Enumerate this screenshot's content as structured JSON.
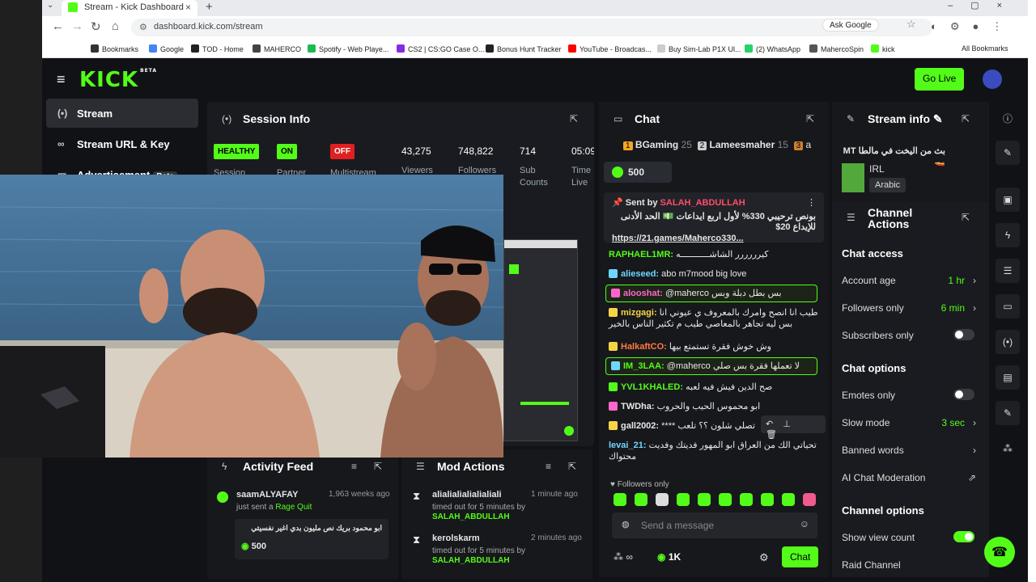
{
  "browser": {
    "tab_title": "Stream - Kick Dashboard",
    "url": "dashboard.kick.com/stream",
    "ask_google": "Ask Google",
    "bookmarks": [
      "Bookmarks",
      "Google",
      "TOD - Home",
      "MAHERCO",
      "Spotify - Web Playe...",
      "CS2 | CS:GO Case O...",
      "Bonus Hunt Tracker",
      "YouTube - Broadcas...",
      "Buy Sim-Lab P1X Ul...",
      "(2) WhatsApp",
      "MahercoSpin",
      "kick"
    ],
    "all_bookmarks": "All Bookmarks"
  },
  "app": {
    "logo": "KICK",
    "logo_beta": "BETA",
    "go_live": "Go Live"
  },
  "sidebar": {
    "items": [
      {
        "label": "Stream"
      },
      {
        "label": "Stream URL & Key"
      },
      {
        "label": "Advertisement",
        "badge": "Beta"
      }
    ]
  },
  "session": {
    "title": "Session Info",
    "tags": [
      {
        "label": "HEALTHY",
        "sub": "Session",
        "color": "#53fc18"
      },
      {
        "label": "ON",
        "sub": "Partner",
        "color": "#53fc18"
      },
      {
        "label": "OFF",
        "sub": "Multistream",
        "color": "#e02020"
      }
    ],
    "stats": [
      {
        "value": "43,275",
        "label": "Viewers"
      },
      {
        "value": "748,822",
        "label": "Followers"
      },
      {
        "value": "714",
        "label": "Sub Counts"
      },
      {
        "value": "05:09",
        "label": "Time Live"
      }
    ]
  },
  "chat": {
    "title": "Chat",
    "leaderboard": [
      {
        "rank": "1",
        "name": "BGaming",
        "value": "25"
      },
      {
        "rank": "2",
        "name": "Lameesmaher",
        "value": "15"
      },
      {
        "rank": "3",
        "name": "a",
        "value": ""
      }
    ],
    "goal_value": "500",
    "pinned": {
      "sent_by": "Sent by",
      "user": "SALAH_ABDULLAH",
      "text": "بونص ترحيبي 330% لأول اربع ايداعات 💵 الحد الأدنى للإيداع 20$",
      "link": "https://21.games/Maherco330..."
    },
    "messages": [
      {
        "user": "RAPHAEL1MR:",
        "text": "كيرررررر الشاشـــــــــــه",
        "color": "#53fc18"
      },
      {
        "user": "alieseed:",
        "text": "abo m7mood big love",
        "color": "#6fd6ff"
      },
      {
        "user": "alooshat:",
        "text": "@maherco بس بطل دبلة وبس",
        "color": "#ff66cc",
        "hl": true
      },
      {
        "user": "mizgagi:",
        "text": "طيب انا انصح وامرك بالمعروف ي عيوني انا بس ليه تجاهر بالمعاصي طيب م تكثير الناس بالخير",
        "color": "#f5d547"
      },
      {
        "user": "HalkaftCO:",
        "text": "وش خوش فقرة تستمتع بيها",
        "color": "#ff7a3d"
      },
      {
        "user": "IM_3LAA:",
        "text": "@maherco لا تعملها فقرة بس صلي",
        "color": "#53fc18",
        "hl": true
      },
      {
        "user": "YVL1KHALED:",
        "text": "صح الدين فيش فيه لعبه",
        "color": "#53fc18"
      },
      {
        "user": "TWDha:",
        "text": "ابو محموس الحيب والحروب",
        "color": "#e8e8e8"
      },
      {
        "user": "gall2002:",
        "text": "**** تصلي شلون ؟؟ تلعب",
        "color": "#e8e8e8"
      },
      {
        "user": "levai_21:",
        "text": "تحياتي الك من العراق ابو المهور فديتك وفديت محتواك",
        "color": "#6fd6ff"
      }
    ],
    "followers_only": "Followers only",
    "send_placeholder": "Send a message",
    "count": "1K",
    "send_button": "Chat"
  },
  "stream_info": {
    "title": "Stream info",
    "stream_title": "بث من اليخت في مالطا MT 🚤",
    "category": "IRL",
    "language": "Arabic"
  },
  "channel_actions": {
    "title": "Channel Actions",
    "chat_access": "Chat access",
    "account_age": {
      "label": "Account age",
      "value": "1 hr"
    },
    "followers_only": {
      "label": "Followers only",
      "value": "6 min"
    },
    "subscribers_only": {
      "label": "Subscribers only"
    },
    "chat_options": "Chat options",
    "emotes_only": {
      "label": "Emotes only"
    },
    "slow_mode": {
      "label": "Slow mode",
      "value": "3 sec"
    },
    "banned_words": {
      "label": "Banned words"
    },
    "ai_moderation": {
      "label": "AI Chat Moderation"
    },
    "channel_options": "Channel options",
    "show_view_count": {
      "label": "Show view count"
    },
    "raid_channel": {
      "label": "Raid Channel"
    }
  },
  "activity_feed": {
    "title": "Activity Feed",
    "items": [
      {
        "user": "saamALYAFAY",
        "time": "1,963 weeks ago",
        "action": "just sent a",
        "item": "Rage Quit",
        "message": "ابو محمود بريك نص مليون بدي اغير نفسيتي",
        "amount": "500"
      }
    ]
  },
  "mod_actions": {
    "title": "Mod Actions",
    "items": [
      {
        "user": "alialialialialialiali",
        "time": "1 minute ago",
        "text": "timed out for 5 minutes by",
        "by": "SALAH_ABDULLAH"
      },
      {
        "user": "kerolskarm",
        "time": "2 minutes ago",
        "text": "timed out for 5 minutes by",
        "by": "SALAH_ABDULLAH"
      }
    ]
  }
}
